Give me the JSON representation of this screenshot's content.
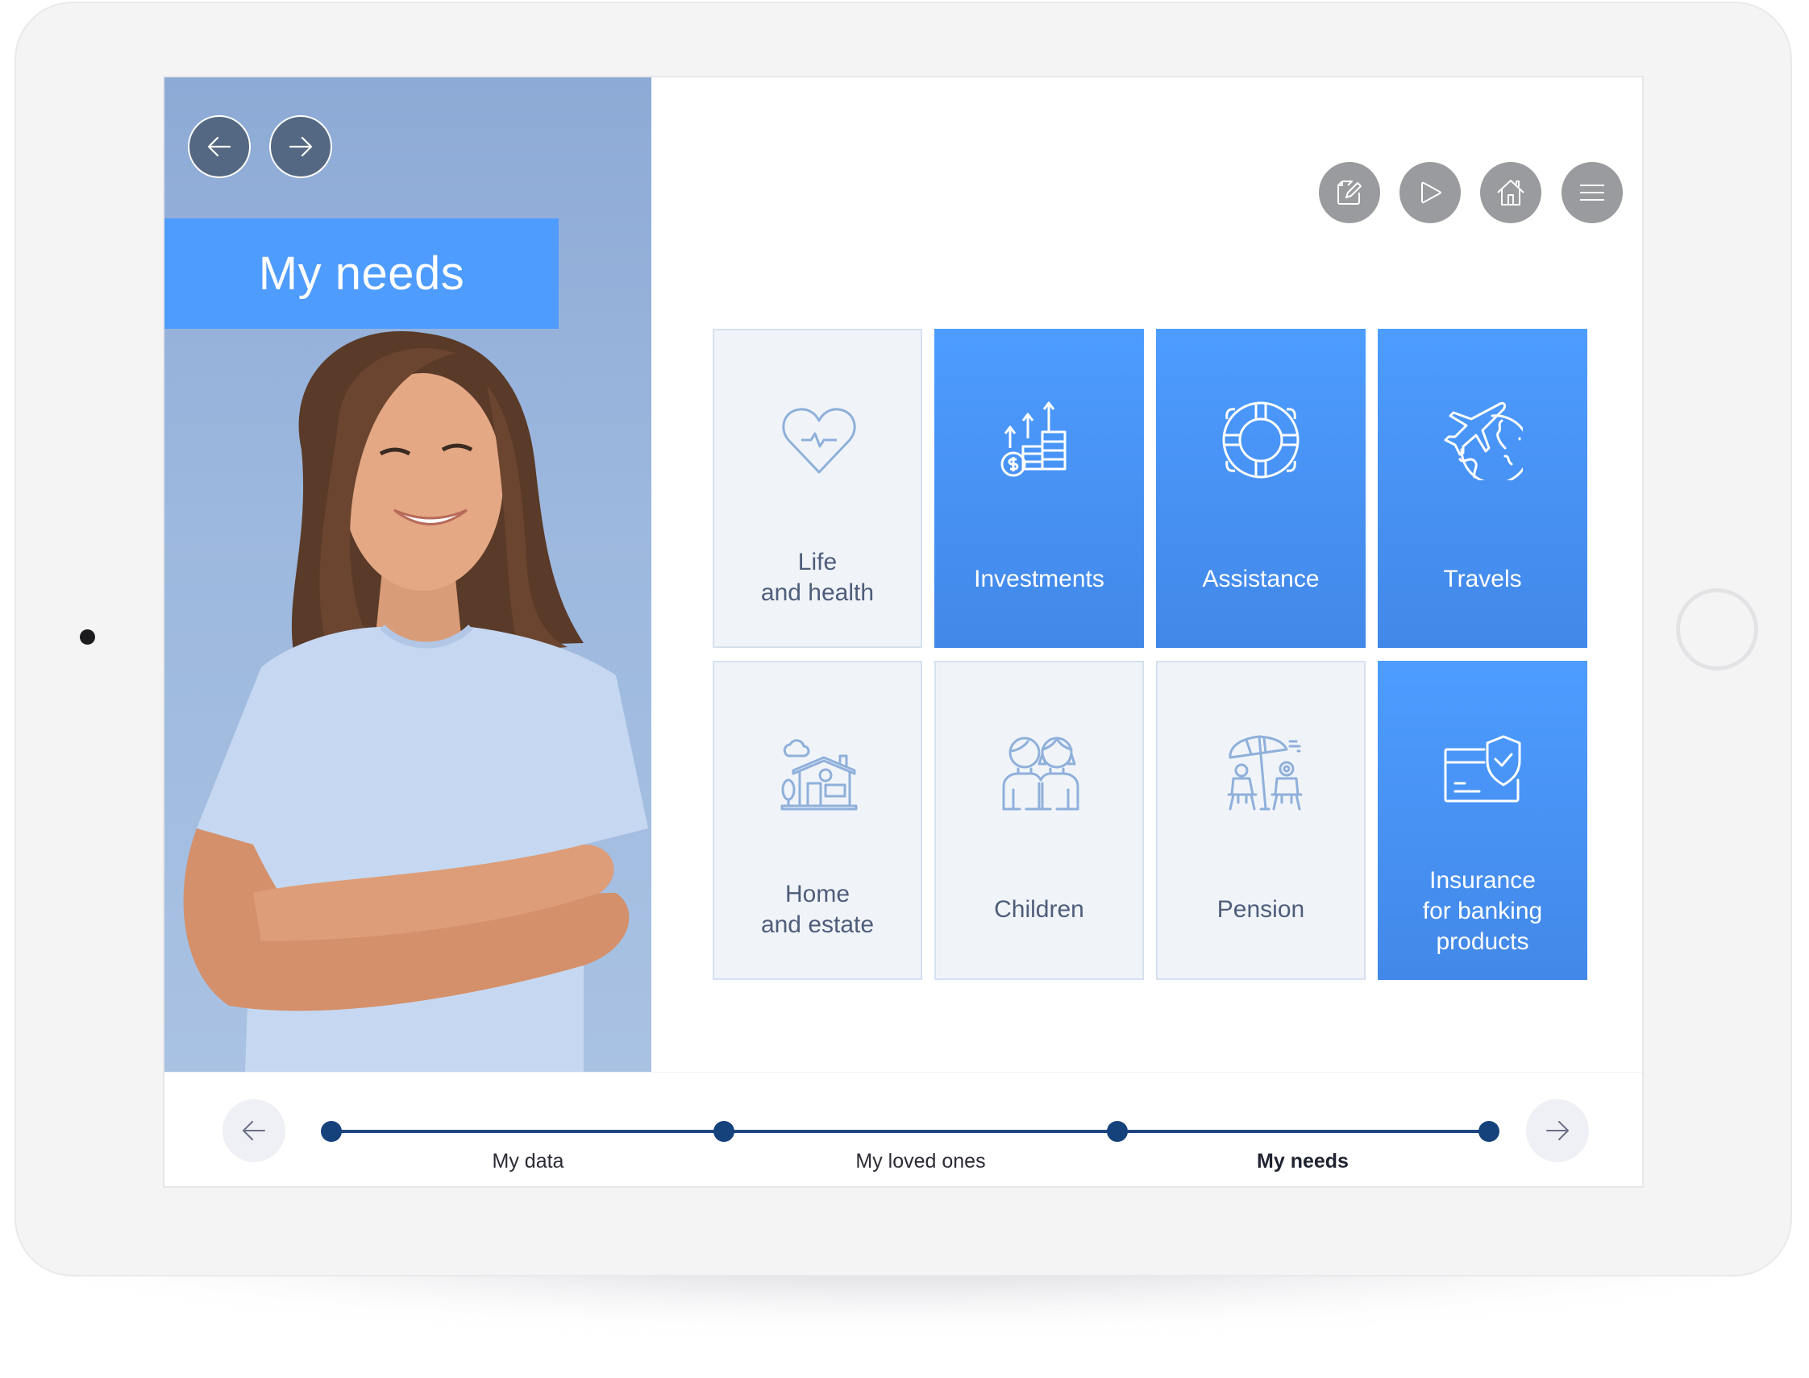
{
  "page": {
    "title": "My needs"
  },
  "header": {
    "back_icon": "arrow-left-icon",
    "forward_icon": "arrow-right-icon",
    "tools": [
      {
        "name": "edit",
        "icon": "edit-document-icon"
      },
      {
        "name": "play",
        "icon": "play-icon"
      },
      {
        "name": "home",
        "icon": "home-icon"
      },
      {
        "name": "menu",
        "icon": "menu-icon"
      }
    ]
  },
  "tiles": [
    {
      "id": "life-health",
      "lines": [
        "Life",
        "and health"
      ],
      "style": "light",
      "icon": "heart-pulse-icon"
    },
    {
      "id": "investments",
      "lines": [
        "Investments"
      ],
      "style": "blue",
      "icon": "coins-growth-icon"
    },
    {
      "id": "assistance",
      "lines": [
        "Assistance"
      ],
      "style": "blue",
      "icon": "lifebuoy-icon"
    },
    {
      "id": "travels",
      "lines": [
        "Travels"
      ],
      "style": "blue",
      "icon": "plane-globe-icon"
    },
    {
      "id": "home-estate",
      "lines": [
        "Home",
        "and estate"
      ],
      "style": "light",
      "icon": "house-icon"
    },
    {
      "id": "children",
      "lines": [
        "Children"
      ],
      "style": "light",
      "icon": "children-icon"
    },
    {
      "id": "pension",
      "lines": [
        "Pension"
      ],
      "style": "light",
      "icon": "beach-chairs-icon"
    },
    {
      "id": "insurance-banking",
      "lines": [
        "Insurance",
        "for banking",
        "products"
      ],
      "style": "blue",
      "icon": "card-shield-icon"
    }
  ],
  "progress": {
    "steps": [
      "My data",
      "My loved ones",
      "My needs"
    ],
    "active_step": 2,
    "completed_fraction": 1.0,
    "prev_icon": "arrow-left-icon",
    "next_icon": "arrow-right-icon"
  },
  "colors": {
    "accent_blue": "#4f9cff",
    "tile_light": "#f0f4f9",
    "track": "#1d477f",
    "tool_button": "#9a9b9e",
    "nav_button": "#556883"
  }
}
